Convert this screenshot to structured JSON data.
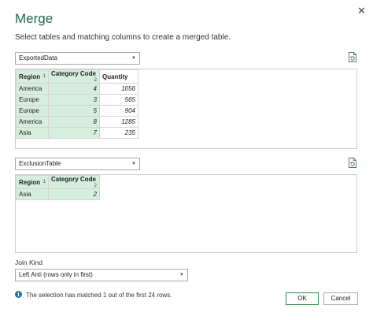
{
  "dialog": {
    "title": "Merge",
    "subtitle": "Select tables and matching columns to create a merged table.",
    "close_icon": "close-icon"
  },
  "first_table": {
    "selected": "ExportedData",
    "columns": [
      {
        "name": "Region",
        "index": "1"
      },
      {
        "name": "Category Code",
        "index": "2"
      },
      {
        "name": "Quantity",
        "index": ""
      }
    ],
    "rows": [
      [
        "America",
        "4",
        "1056"
      ],
      [
        "Europe",
        "3",
        "565"
      ],
      [
        "Europe",
        "5",
        "904"
      ],
      [
        "America",
        "8",
        "1285"
      ],
      [
        "Asia",
        "7",
        "235"
      ]
    ]
  },
  "second_table": {
    "selected": "ExclusionTable",
    "columns": [
      {
        "name": "Region",
        "index": "1"
      },
      {
        "name": "Category Code",
        "index": "2"
      }
    ],
    "rows": [
      [
        "Asia",
        "2"
      ]
    ]
  },
  "join": {
    "label": "Join Kind",
    "selected": "Left Anti (rows only in first)"
  },
  "status": {
    "icon": "info-icon",
    "text": "The selection has matched 1 out of the first 24 rows."
  },
  "buttons": {
    "ok": "OK",
    "cancel": "Cancel"
  },
  "colors": {
    "accent": "#1f6b46",
    "selected_column": "#d6eedd",
    "info": "#1e6fb5"
  }
}
